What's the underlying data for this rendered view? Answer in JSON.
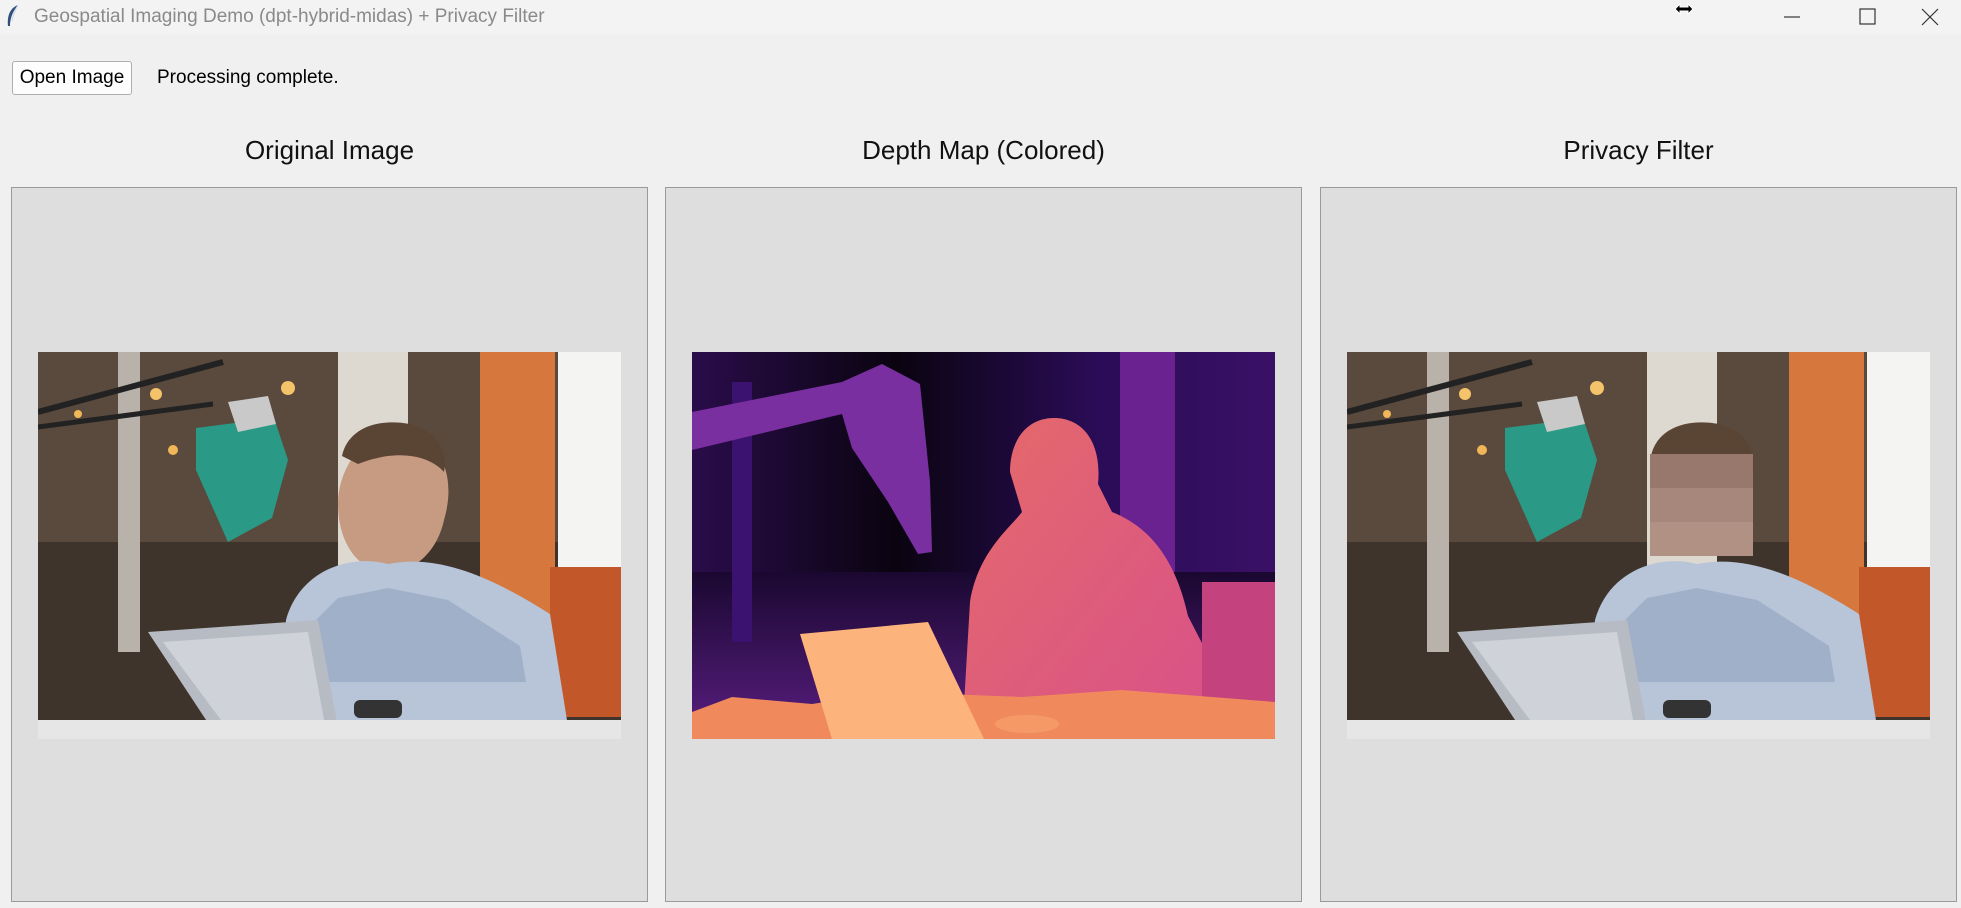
{
  "window": {
    "title": "Geospatial Imaging Demo (dpt-hybrid-midas) + Privacy Filter",
    "icons": [
      "feather-icon",
      "resize-cursor-icon",
      "minimize-icon",
      "maximize-icon",
      "close-icon"
    ]
  },
  "toolbar": {
    "open_button_label": "Open Image",
    "status": "Processing complete."
  },
  "panels": [
    {
      "title": "Original Image",
      "content": "photo"
    },
    {
      "title": "Depth Map (Colored)",
      "content": "depth-map"
    },
    {
      "title": "Privacy Filter",
      "content": "photo-face-blurred"
    }
  ],
  "colors": {
    "window_bg": "#f0f0f0",
    "panel_bg": "#dedede",
    "panel_border": "#9a9a9a",
    "title_text": "#8a8a8a"
  }
}
